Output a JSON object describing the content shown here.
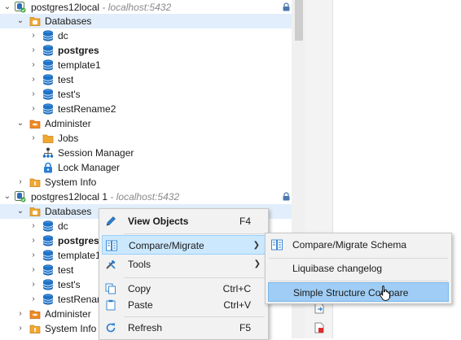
{
  "tree": {
    "items": [
      {
        "label": "postgres12local",
        "host": " - localhost:5432"
      },
      {
        "label": "Databases"
      },
      {
        "label": "dc"
      },
      {
        "label": "postgres"
      },
      {
        "label": "template1"
      },
      {
        "label": "test"
      },
      {
        "label": "test's"
      },
      {
        "label": "testRename2"
      },
      {
        "label": "Administer"
      },
      {
        "label": "Jobs"
      },
      {
        "label": "Session Manager"
      },
      {
        "label": "Lock Manager"
      },
      {
        "label": "System Info"
      },
      {
        "label": "postgres12local 1",
        "host": " - localhost:5432"
      },
      {
        "label": "Databases"
      },
      {
        "label": "dc"
      },
      {
        "label": "postgres"
      },
      {
        "label": "template1"
      },
      {
        "label": "test"
      },
      {
        "label": "test's"
      },
      {
        "label": "testRenam"
      },
      {
        "label": "Administer"
      },
      {
        "label": "System Info"
      }
    ]
  },
  "context_menu": {
    "items": [
      {
        "label": "View Objects",
        "shortcut": "F4"
      },
      {
        "label": "Compare/Migrate"
      },
      {
        "label": "Tools"
      },
      {
        "label": "Copy",
        "shortcut": "Ctrl+C"
      },
      {
        "label": "Paste",
        "shortcut": "Ctrl+V"
      },
      {
        "label": "Refresh",
        "shortcut": "F5"
      }
    ]
  },
  "submenu": {
    "items": [
      {
        "label": "Compare/Migrate Schema"
      },
      {
        "label": "Liquibase changelog"
      },
      {
        "label": "Simple Structure Compare"
      }
    ]
  },
  "colors": {
    "selection": "#e2eefb",
    "menu_highlight": "#cce8ff",
    "submenu_highlight": "#9fcdf5",
    "database_icon": "#1e73c8",
    "folder_icon": "#f0a830"
  }
}
